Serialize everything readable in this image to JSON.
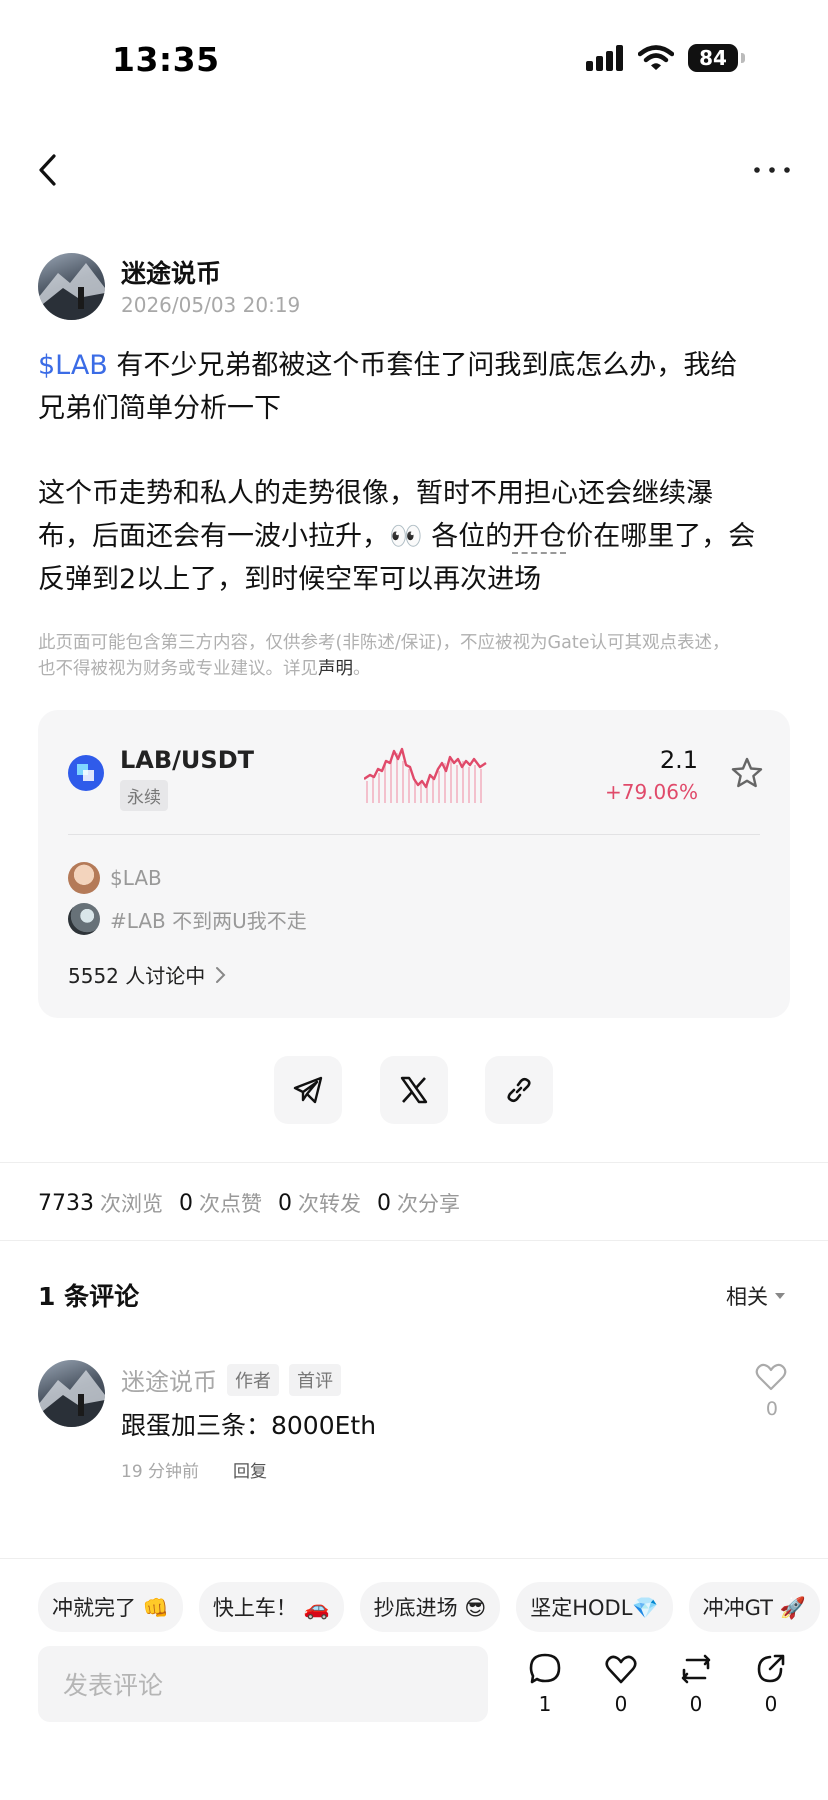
{
  "status_bar": {
    "time": "13:35",
    "battery": "84"
  },
  "author": {
    "name": "迷途说币",
    "time": "2026/05/03 20:19"
  },
  "post": {
    "tag": "$LAB",
    "line1": " 有不少兄弟都被这个币套住了问我到底怎么办，我给",
    "line2": "兄弟们简单分析一下",
    "line3": "这个币走势和私人的走势很像，暂时不用担心还会继续瀑",
    "line4_a": "布，后面还会有一波小拉升，👀 各位的",
    "line4_b": "开仓",
    "line4_c": "价在哪里了，会",
    "line5": "反弹到2以上了，到时候空军可以再次进场"
  },
  "disclaimer": {
    "line1": "此页面可能包含第三方内容，仅供参考(非陈述/保证)，不应被视为Gate认可其观点表述，",
    "line2_prefix": "也不得被视为财务或专业建议。详见",
    "link": "声明",
    "line2_suffix": "。"
  },
  "market": {
    "pair": "LAB/USDT",
    "badge": "永续",
    "price": "2.1",
    "change": "+79.06%",
    "up_color": "#e04a6a"
  },
  "topics": [
    "$LAB",
    "#LAB 不到两U我不走"
  ],
  "discussion": "5552 人讨论中",
  "stats": {
    "views": "7733",
    "views_label": "次浏览",
    "likes": "0",
    "likes_label": "次点赞",
    "reposts": "0",
    "reposts_label": "次转发",
    "shares": "0",
    "shares_label": "次分享"
  },
  "comments": {
    "title": "1 条评论",
    "sort": "相关",
    "items": [
      {
        "name": "迷途说币",
        "badge_author": "作者",
        "badge_first": "首评",
        "text": "跟蛋加三条：8000Eth",
        "time": "19 分钟前",
        "reply": "回复",
        "likes": "0"
      }
    ]
  },
  "quick_replies": [
    "冲就完了 👊",
    "快上车！ 🚗",
    "抄底进场 😎",
    "坚定HODL💎",
    "冲冲GT 🚀"
  ],
  "bottom_bar": {
    "placeholder": "发表评论",
    "comment_count": "1",
    "like_count": "0",
    "repost_count": "0",
    "share_count": "0"
  }
}
